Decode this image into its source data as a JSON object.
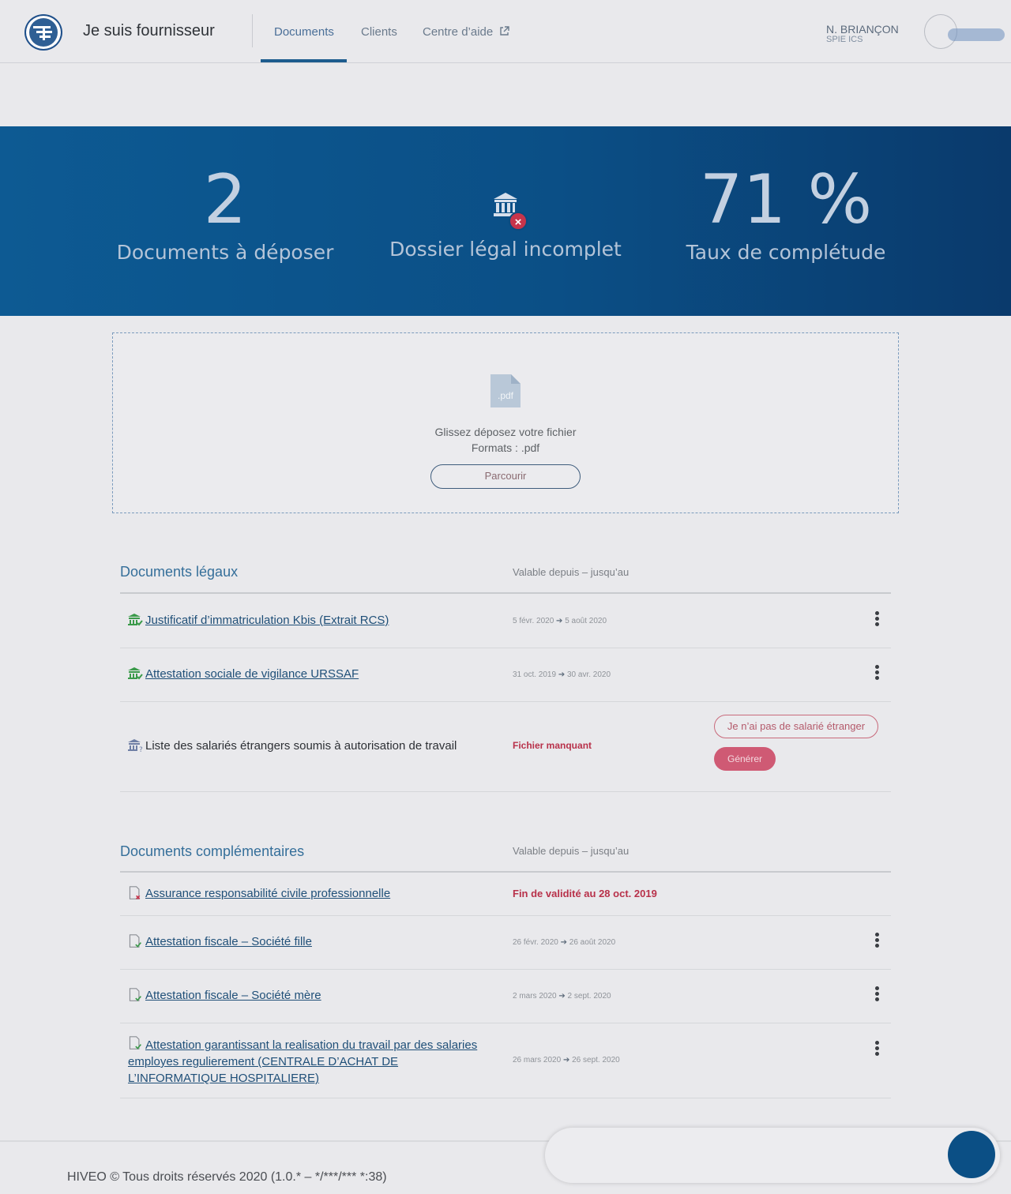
{
  "header": {
    "brand": "Je suis fournisseur",
    "nav": {
      "documents": "Documents",
      "clients": "Clients",
      "help": "Centre d’aide"
    },
    "user": {
      "name": "N. BRIANÇON",
      "company": "SPIE ICS"
    }
  },
  "stats": {
    "documents_count": "2",
    "documents_label": "Documents à déposer",
    "legal_label": "Dossier légal incomplet",
    "completion_value": "71 %",
    "completion_label": "Taux de complétude"
  },
  "dropzone": {
    "file_icon_label": ".pdf",
    "instruction": "Glissez déposez votre fichier",
    "formats": "Formats : .pdf",
    "browse_label": "Parcourir"
  },
  "legal": {
    "title": "Documents légaux",
    "column": "Valable depuis – jusqu’au",
    "rows": [
      {
        "label": "Justificatif d’immatriculation Kbis (Extrait RCS)",
        "from": "5 févr. 2020",
        "to": "5 août 2020"
      },
      {
        "label": "Attestation sociale de vigilance URSSAF",
        "from": "31 oct. 2019",
        "to": "30 avr. 2020"
      },
      {
        "label": "Liste des salariés étrangers soumis à autorisation de travail",
        "status": "Fichier manquant",
        "action_outline": "Je n’ai pas de salarié étranger",
        "action_filled": "Générer"
      }
    ]
  },
  "complementary": {
    "title": "Documents complémentaires",
    "column": "Valable depuis – jusqu’au",
    "rows": [
      {
        "label": "Assurance responsabilité civile professionnelle",
        "status": "Fin de validité au 28 oct. 2019"
      },
      {
        "label": "Attestation fiscale – Société fille",
        "from": "26 févr. 2020",
        "to": "26 août 2020"
      },
      {
        "label": "Attestation fiscale – Société mère",
        "from": "2 mars 2020",
        "to": "2 sept. 2020"
      },
      {
        "label": "Attestation garantissant la realisation du travail par des salaries employes regulierement (CENTRALE D’ACHAT DE L’INFORMATIQUE HOSPITALIERE)",
        "from": "26 mars 2020",
        "to": "26 sept. 2020"
      }
    ]
  },
  "footer": {
    "copyright": "HIVEO © Tous droits réservés 2020 (1.0.* – */***/*** *:38)"
  },
  "colors": {
    "band": "#0b4f86",
    "accent": "#1d5c8e",
    "danger": "#b8314a",
    "valid": "#3b9a4a"
  }
}
